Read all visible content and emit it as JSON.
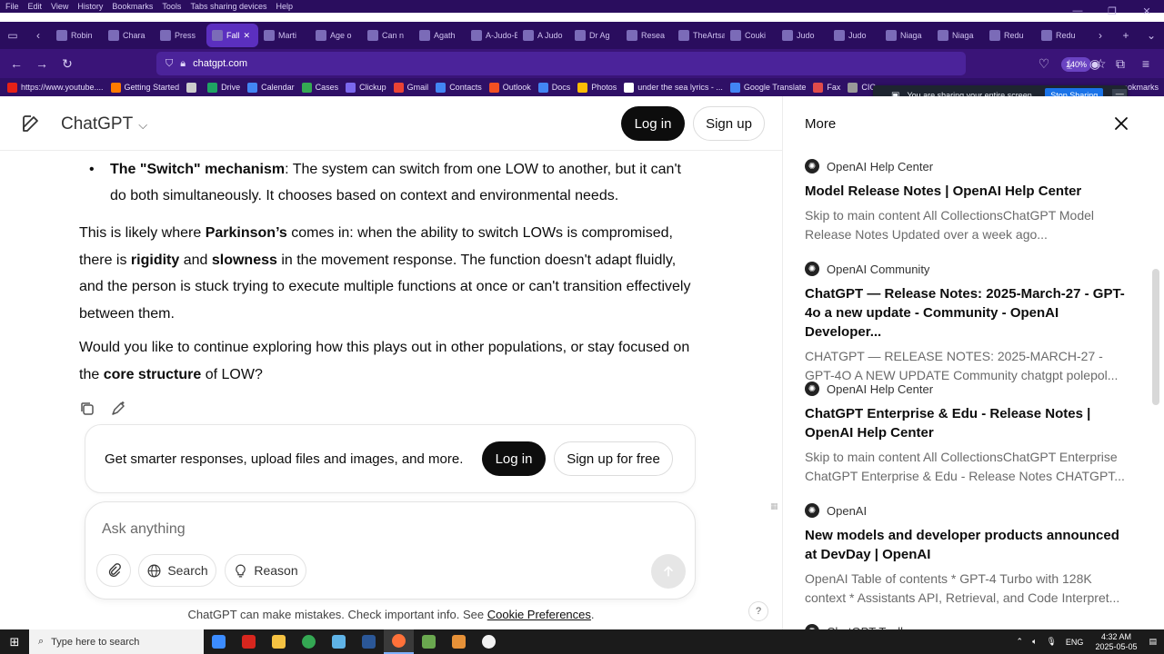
{
  "browser": {
    "menu": [
      "File",
      "Edit",
      "View",
      "History",
      "Bookmarks",
      "Tools",
      "Tabs sharing devices",
      "Help"
    ],
    "tabs": [
      {
        "label": "Robin",
        "active": false
      },
      {
        "label": "Chara",
        "active": false
      },
      {
        "label": "Press",
        "active": false
      },
      {
        "label": "Fall",
        "active": true
      },
      {
        "label": "Marti",
        "active": false
      },
      {
        "label": "Age o",
        "active": false
      },
      {
        "label": "Can n",
        "active": false
      },
      {
        "label": "Agath",
        "active": false
      },
      {
        "label": "A-Judo-B",
        "active": false
      },
      {
        "label": "A Judo",
        "active": false
      },
      {
        "label": "Dr Ag",
        "active": false
      },
      {
        "label": "Resea",
        "active": false
      },
      {
        "label": "TheArtsan",
        "active": false
      },
      {
        "label": "Couki",
        "active": false
      },
      {
        "label": "Judo",
        "active": false
      },
      {
        "label": "Judo",
        "active": false
      },
      {
        "label": "Niaga",
        "active": false
      },
      {
        "label": "Niaga",
        "active": false
      },
      {
        "label": "Redu",
        "active": false
      },
      {
        "label": "Redu",
        "active": false
      }
    ],
    "url": "chatgpt.com",
    "zoom": "140%",
    "bookmarks": [
      {
        "label": "https://www.youtube....",
        "color": "#e62117"
      },
      {
        "label": "Getting Started",
        "color": "#ff7a00"
      },
      {
        "label": "",
        "color": "#cccccc"
      },
      {
        "label": "Drive",
        "color": "#1fa463"
      },
      {
        "label": "Calendar",
        "color": "#4285f4"
      },
      {
        "label": "Cases",
        "color": "#34a853"
      },
      {
        "label": "Clickup",
        "color": "#7b68ee"
      },
      {
        "label": "Gmail",
        "color": "#ea4335"
      },
      {
        "label": "Contacts",
        "color": "#4285f4"
      },
      {
        "label": "Outlook",
        "color": "#f25022"
      },
      {
        "label": "Docs",
        "color": "#4285f4"
      },
      {
        "label": "Photos",
        "color": "#fbbc05"
      },
      {
        "label": "under the sea lyrics - ...",
        "color": "#ffffff"
      },
      {
        "label": "Google Translate",
        "color": "#4285f4"
      },
      {
        "label": "Fax",
        "color": "#e04b4b"
      },
      {
        "label": "CIC",
        "color": "#999999"
      }
    ],
    "bookmarks_overflow": "ookmarks",
    "share_notice": "You are sharing your entire screen.",
    "stop_sharing": "Stop Sharing",
    "share_min": "—"
  },
  "header": {
    "brand": "ChatGPT",
    "login": "Log in",
    "signup": "Sign up"
  },
  "chat": {
    "bullet": {
      "bold": "The \"Switch\" mechanism",
      "text": ": The system can switch from one LOW to another, but it can't do both simultaneously. It chooses based on context and environmental needs."
    },
    "para1": {
      "t1": "This is likely where ",
      "b1": "Parkinson’s",
      "t2": " comes in: when the ability to switch LOWs is compromised, there is ",
      "b2": "rigidity",
      "t3": " and ",
      "b3": "slowness",
      "t4": " in the movement response. The function doesn't adapt fluidly, and the person is stuck trying to execute multiple functions at once or can't transition effectively between them."
    },
    "para2": {
      "t1": "Would you like to continue exploring how this plays out in other populations, or stay focused on the ",
      "b1": "core structure",
      "t2": " of LOW?"
    }
  },
  "cta": {
    "text": "Get smarter responses, upload files and images, and more.",
    "login": "Log in",
    "signup": "Sign up for free"
  },
  "composer": {
    "placeholder": "Ask anything",
    "search": "Search",
    "reason": "Reason"
  },
  "footer": {
    "disclaimer": "ChatGPT can make mistakes. Check important info. See ",
    "link": "Cookie Preferences",
    "end": ".",
    "help": "?"
  },
  "more_panel": {
    "title": "More",
    "sources": [
      {
        "site": "OpenAI Help Center",
        "title": "Model Release Notes | OpenAI Help Center",
        "snippet": "Skip to main content All CollectionsChatGPT Model Release Notes Updated over a week ago..."
      },
      {
        "site": "OpenAI Community",
        "title": "ChatGPT — Release Notes: 2025-March-27 - GPT-4o a new update - Community - OpenAI Developer...",
        "snippet": "CHATGPT — RELEASE NOTES: 2025-MARCH-27 - GPT-4O A NEW UPDATE Community chatgpt polepol..."
      },
      {
        "site": "OpenAI Help Center",
        "title": "ChatGPT Enterprise & Edu - Release Notes | OpenAI Help Center",
        "snippet": "Skip to main content All CollectionsChatGPT Enterprise ChatGPT Enterprise & Edu - Release Notes CHATGPT..."
      },
      {
        "site": "OpenAI",
        "title": "New models and developer products announced at DevDay | OpenAI",
        "snippet": "OpenAI Table of contents * GPT-4 Turbo with 128K context * Assistants API, Retrieval, and Code Interpret..."
      },
      {
        "site": "ChatGPT Toolbox",
        "title": "",
        "snippet": ""
      }
    ]
  },
  "taskbar": {
    "search_placeholder": "Type here to search",
    "apps": [
      {
        "name": "copilot",
        "color": "#3c8cff"
      },
      {
        "name": "acrobat",
        "color": "#d7261e"
      },
      {
        "name": "file-explorer",
        "color": "#f5c242"
      },
      {
        "name": "chrome",
        "color": "#34a853"
      },
      {
        "name": "notepad",
        "color": "#5fb3e6"
      },
      {
        "name": "calculator",
        "color": "#2b5797"
      },
      {
        "name": "firefox",
        "color": "#ff7139"
      },
      {
        "name": "app-green",
        "color": "#6aa84f"
      },
      {
        "name": "app-orange",
        "color": "#e69138"
      },
      {
        "name": "chatgpt",
        "color": "#f2f2f2"
      }
    ],
    "lang": "ENG",
    "time": "4:32 AM",
    "date": "2025-05-05"
  }
}
